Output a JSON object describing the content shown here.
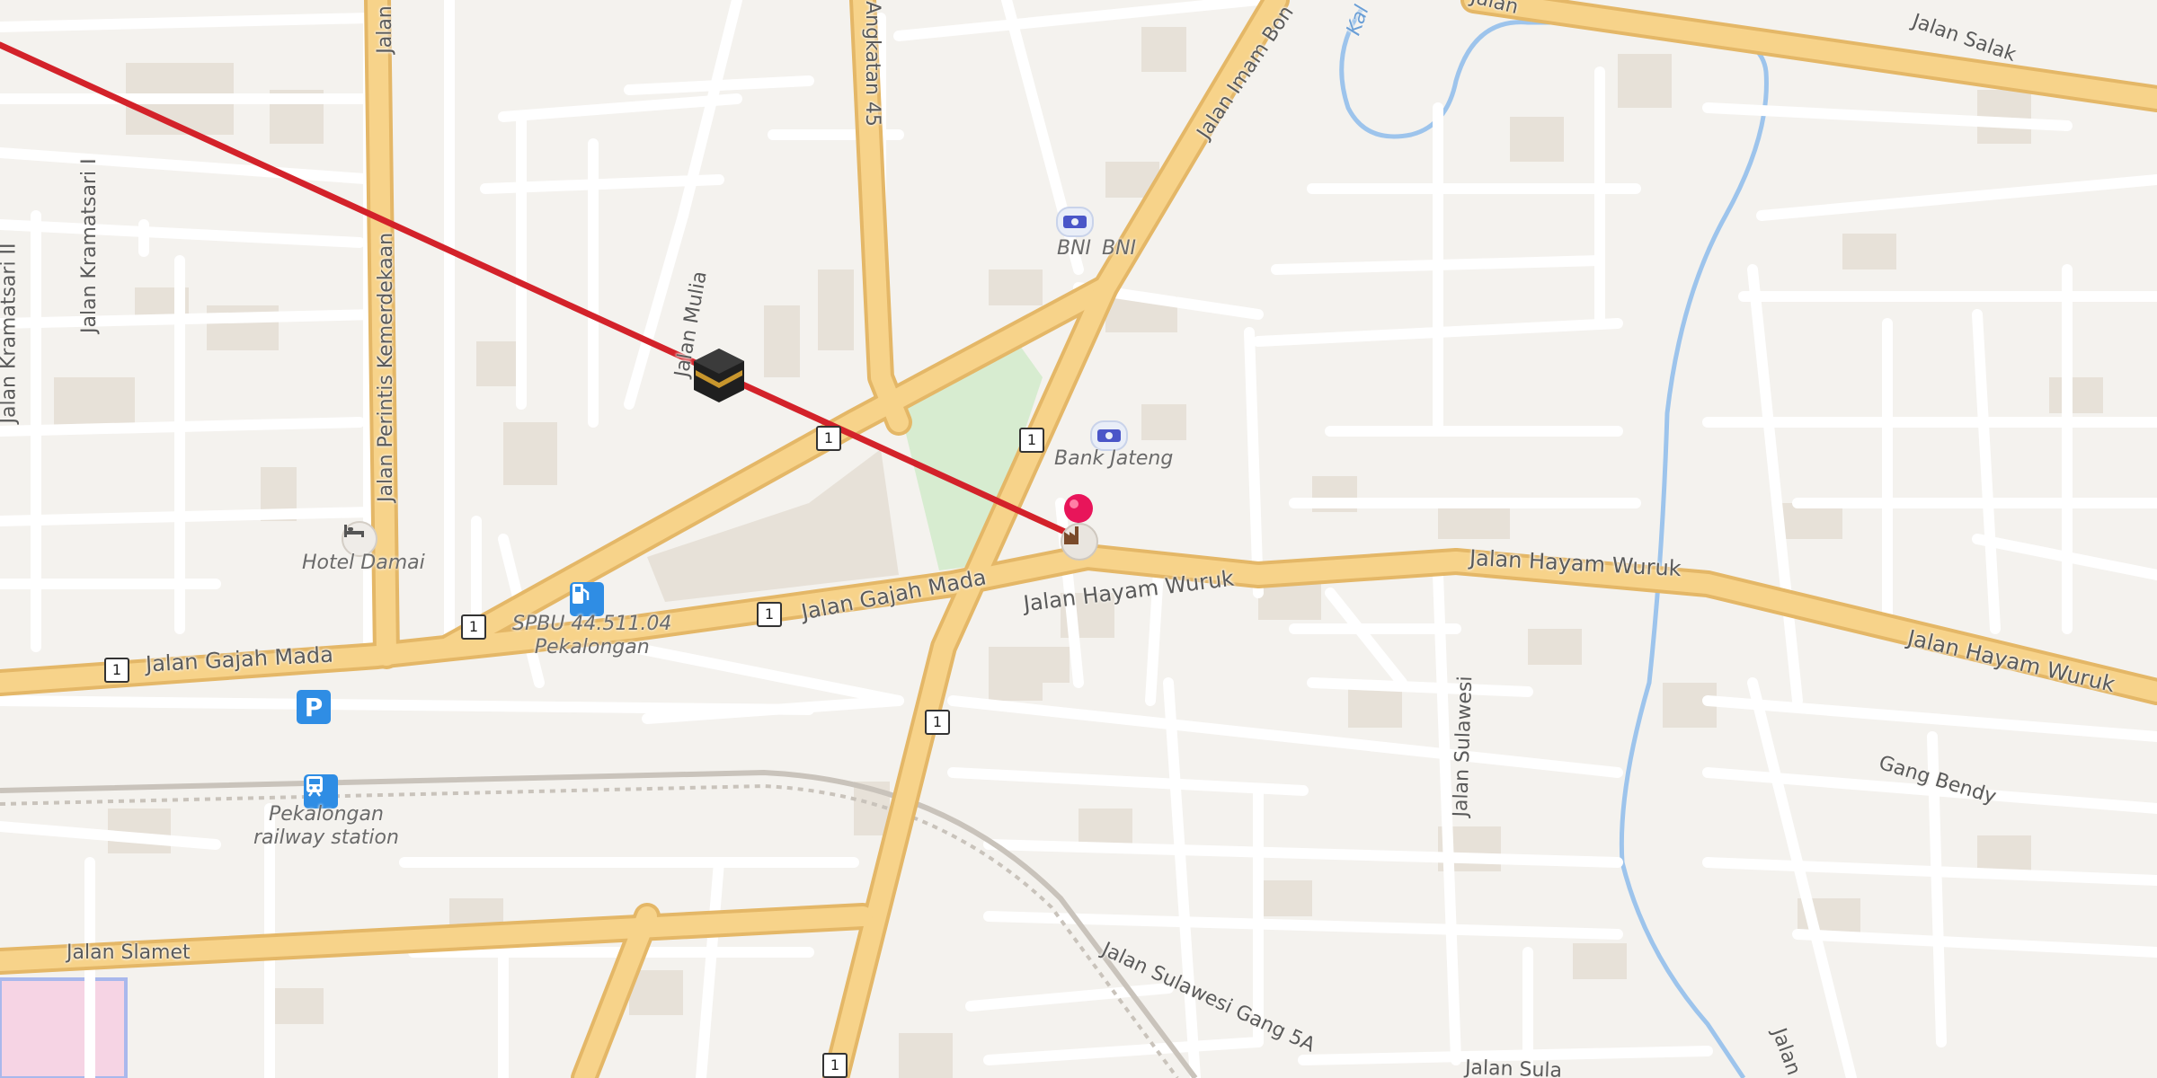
{
  "colors": {
    "background": "#f4f2ee",
    "building": "#e6dfd6",
    "minor_road": "#ffffff",
    "major_road_fill": "#f7d38a",
    "major_road_casing": "#e4b767",
    "park": "#d7ecd0",
    "river": "#9dc4ec",
    "route_line": "#d3222a",
    "marker": "#e8155a"
  },
  "road_labels": {
    "gajah_mada_west": "Jalan Gajah Mada",
    "gajah_mada_center": "Jalan Gajah Mada",
    "hayam_wuruk_center": "Jalan Hayam Wuruk",
    "hayam_wuruk_east": "Jalan Hayam Wuruk",
    "hayam_wuruk_far_east": "Jalan Hayam Wuruk",
    "kramatsari_ii": "Jalan Kramatsari II",
    "kramatsari_i": "Jalan Kramatsari I",
    "perintis": "Jalan Perintis Kemerdekaan",
    "jalan_top": "Jalan",
    "mulia": "Jalan Mulia",
    "angkatan": "Angkatan 45",
    "imam_bonjol": "Jalan Imam Bon",
    "salak": "Jalan Salak",
    "sulawesi": "Jalan Sulawesi",
    "sulawesi_gang": "Jalan Sulawesi Gang 5A",
    "sulawesi_bottom": "Jalan Sula",
    "gang_bendy": "Gang Bendy",
    "slamet": "Jalan Slamet",
    "jalan_bottom_right": "Jalan",
    "kali_top": "Kal",
    "jalan_top_right": "Jalan"
  },
  "pois": {
    "bni_label": "BNI",
    "bni_label2": "BNI",
    "bank_jateng": "Bank Jateng",
    "hotel": "Hotel Damai",
    "spbu_line1": "SPBU 44.511.04",
    "spbu_line2": "Pekalongan",
    "station_line1": "Pekalongan",
    "station_line2": "railway station",
    "parking_symbol": "P"
  },
  "route_shields": {
    "s1": "1",
    "s2": "1",
    "s3": "1",
    "s4": "1",
    "s5": "1",
    "s6": "1",
    "s7": "1"
  },
  "icons": {
    "kaaba": "kaaba-icon",
    "marker": "location-pin-icon",
    "bank": "bank-icon",
    "hotel": "hotel-bed-icon",
    "fuel": "fuel-station-icon",
    "parking": "parking-icon",
    "train": "train-station-icon",
    "factory": "factory-icon"
  }
}
